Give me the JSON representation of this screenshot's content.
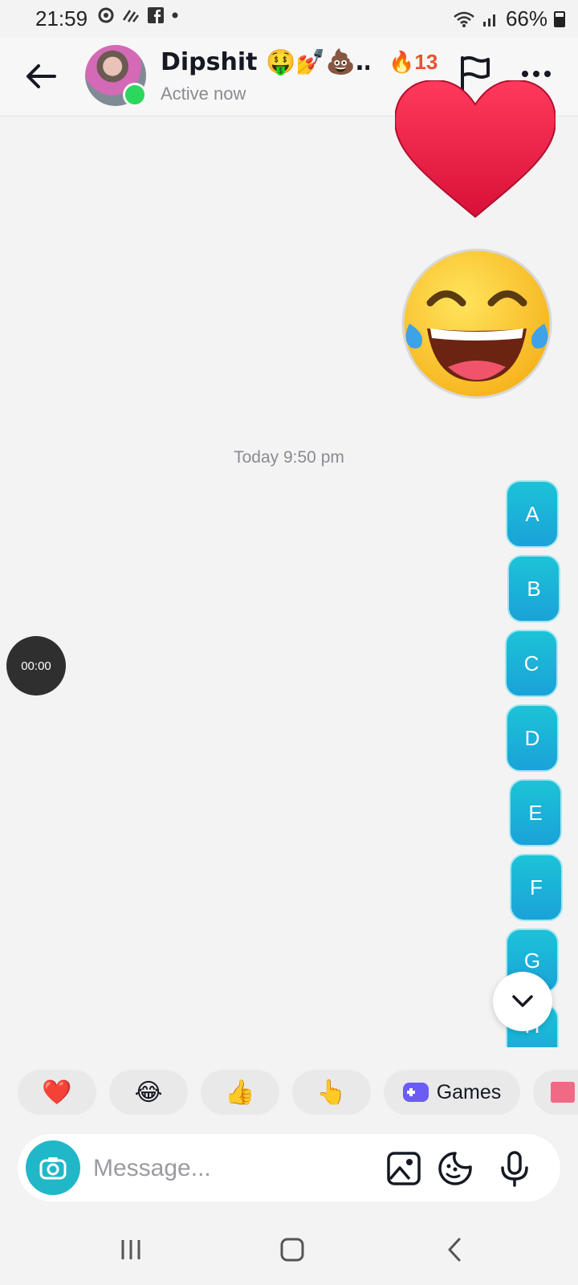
{
  "status_bar": {
    "time": "21:59",
    "battery": "66%",
    "left_icons": [
      "chrome-icon",
      "signal-arrows-icon",
      "facebook-icon",
      "dot-icon"
    ],
    "right_icons": [
      "wifi-icon",
      "cell-signal-icon",
      "battery-icon"
    ]
  },
  "header": {
    "contact_name": "Dipshit 🤑💅💩…",
    "contact_status": "Active now",
    "streak_emoji": "🔥",
    "streak_count": "13",
    "icons": [
      "back-arrow-icon",
      "flag-icon",
      "more-icon"
    ]
  },
  "conversation": {
    "stickers": [
      "heart-sticker",
      "laughing-emoji-sticker"
    ],
    "timestamp": "Today 9:50 pm",
    "letter_messages": [
      "A",
      "B",
      "C",
      "D",
      "E",
      "F",
      "G",
      "H"
    ],
    "recording_timer": "00:00"
  },
  "quick_reactions": {
    "emojis": [
      "❤️",
      "😂",
      "👍",
      "👆"
    ],
    "games_label": "Games"
  },
  "composer": {
    "placeholder": "Message...",
    "icons": [
      "camera-icon",
      "gallery-icon",
      "sticker-icon",
      "microphone-icon"
    ]
  },
  "colors": {
    "accent": "#20b8c9",
    "bubble_top": "#1cc3d7",
    "bubble_bottom": "#1aa2d8",
    "streak": "#e8532e",
    "online": "#2bd75c",
    "background": "#f3f3f3"
  }
}
